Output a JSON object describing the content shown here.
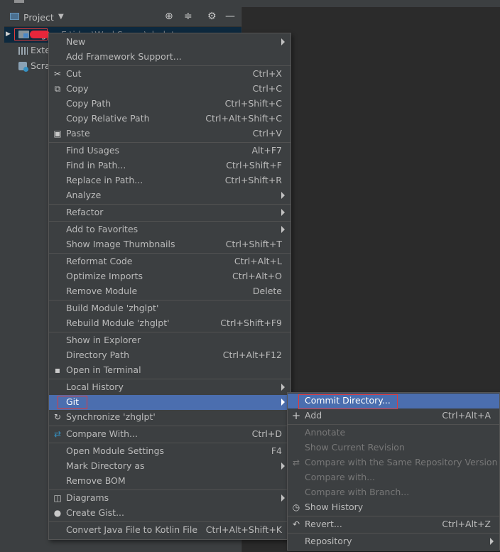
{
  "panel": {
    "title": "Project",
    "tree": [
      {
        "label": "zhg",
        "tail": "E:\\idea\\WorkSpace\\zhglpt"
      },
      {
        "label": "Exte"
      },
      {
        "label": "Scra"
      }
    ]
  },
  "context_menu": {
    "items": {
      "new": {
        "label": "New"
      },
      "add_framework": {
        "label": "Add Framework Support..."
      },
      "cut": {
        "label": "Cut",
        "shortcut": "Ctrl+X"
      },
      "copy": {
        "label": "Copy",
        "shortcut": "Ctrl+C"
      },
      "copy_path": {
        "label": "Copy Path",
        "shortcut": "Ctrl+Shift+C"
      },
      "copy_relative_path": {
        "label": "Copy Relative Path",
        "shortcut": "Ctrl+Alt+Shift+C"
      },
      "paste": {
        "label": "Paste",
        "shortcut": "Ctrl+V"
      },
      "find_usages": {
        "label": "Find Usages",
        "shortcut": "Alt+F7"
      },
      "find_in_path": {
        "label": "Find in Path...",
        "shortcut": "Ctrl+Shift+F"
      },
      "replace_in_path": {
        "label": "Replace in Path...",
        "shortcut": "Ctrl+Shift+R"
      },
      "analyze": {
        "label": "Analyze"
      },
      "refactor": {
        "label": "Refactor"
      },
      "add_to_favorites": {
        "label": "Add to Favorites"
      },
      "show_thumbnails": {
        "label": "Show Image Thumbnails",
        "shortcut": "Ctrl+Shift+T"
      },
      "reformat_code": {
        "label": "Reformat Code",
        "shortcut": "Ctrl+Alt+L"
      },
      "optimize_imports": {
        "label": "Optimize Imports",
        "shortcut": "Ctrl+Alt+O"
      },
      "remove_module": {
        "label": "Remove Module",
        "shortcut": "Delete"
      },
      "build_module": {
        "label": "Build Module 'zhglpt'"
      },
      "rebuild_module": {
        "label": "Rebuild Module 'zhglpt'",
        "shortcut": "Ctrl+Shift+F9"
      },
      "show_in_explorer": {
        "label": "Show in Explorer"
      },
      "directory_path": {
        "label": "Directory Path",
        "shortcut": "Ctrl+Alt+F12"
      },
      "open_in_terminal": {
        "label": "Open in Terminal"
      },
      "local_history": {
        "label": "Local History"
      },
      "git": {
        "label": "Git"
      },
      "synchronize": {
        "label": "Synchronize 'zhglpt'"
      },
      "compare_with": {
        "label": "Compare With...",
        "shortcut": "Ctrl+D"
      },
      "open_module_settings": {
        "label": "Open Module Settings",
        "shortcut": "F4"
      },
      "mark_directory_as": {
        "label": "Mark Directory as"
      },
      "remove_bom": {
        "label": "Remove BOM"
      },
      "diagrams": {
        "label": "Diagrams"
      },
      "create_gist": {
        "label": "Create Gist..."
      },
      "convert_kotlin": {
        "label": "Convert Java File to Kotlin File",
        "shortcut": "Ctrl+Alt+Shift+K"
      }
    }
  },
  "git_menu": {
    "items": {
      "commit_directory": {
        "label": "Commit Directory..."
      },
      "add": {
        "label": "Add",
        "shortcut": "Ctrl+Alt+A"
      },
      "annotate": {
        "label": "Annotate"
      },
      "show_current_revision": {
        "label": "Show Current Revision"
      },
      "compare_same_repo": {
        "label": "Compare with the Same Repository Version"
      },
      "compare_with": {
        "label": "Compare with..."
      },
      "compare_with_branch": {
        "label": "Compare with Branch..."
      },
      "show_history": {
        "label": "Show History"
      },
      "revert": {
        "label": "Revert...",
        "shortcut": "Ctrl+Alt+Z"
      },
      "repository": {
        "label": "Repository"
      }
    }
  },
  "icons": {
    "locate": "crosshair-icon",
    "collapse": "collapse-all-icon",
    "settings": "gear-icon",
    "hide": "minimize-icon"
  },
  "colors": {
    "menu_bg": "#3c3f41",
    "selection": "#4b6eaf",
    "highlight_box": "#e03b3b"
  }
}
